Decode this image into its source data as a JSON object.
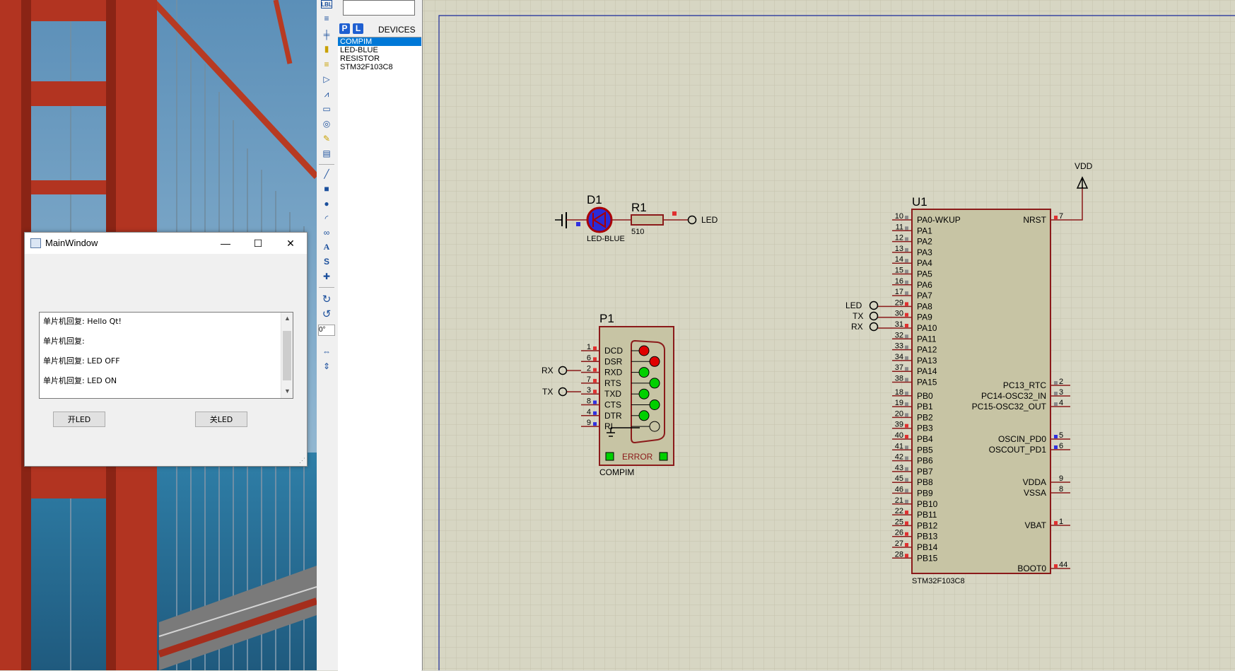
{
  "qt_window": {
    "title": "MainWindow",
    "minimize_glyph": "—",
    "maximize_glyph": "☐",
    "close_glyph": "✕",
    "log_lines": [
      "单片机回复: Hello Qt!",
      "单片机回复:",
      "单片机回复: LED OFF",
      "单片机回复: LED ON"
    ],
    "led_on_button": "开LED",
    "led_off_button": "关LED"
  },
  "device_panel": {
    "p_label": "P",
    "l_label": "L",
    "header": "DEVICES",
    "devices": [
      "COMPIM",
      "LED-BLUE",
      "RESISTOR",
      "STM32F103C8"
    ],
    "selected_index": 0
  },
  "toolbar": {
    "lbl_icon_text": "LBL",
    "rotation_value": "0°"
  },
  "schematic": {
    "d1": {
      "ref": "D1",
      "value": "LED-BLUE"
    },
    "r1": {
      "ref": "R1",
      "value": "510"
    },
    "led_terminal": "LED",
    "p1": {
      "ref": "P1",
      "value": "COMPIM",
      "error_label": "ERROR",
      "pins": [
        {
          "num": "1",
          "name": "DCD"
        },
        {
          "num": "6",
          "name": "DSR"
        },
        {
          "num": "2",
          "name": "RXD"
        },
        {
          "num": "7",
          "name": "RTS"
        },
        {
          "num": "3",
          "name": "TXD"
        },
        {
          "num": "8",
          "name": "CTS"
        },
        {
          "num": "4",
          "name": "DTR"
        },
        {
          "num": "9",
          "name": "RI"
        }
      ],
      "terminals": [
        "RX",
        "TX"
      ]
    },
    "vdd_label": "VDD",
    "u1": {
      "ref": "U1",
      "value": "STM32F103C8",
      "left_pins": [
        {
          "num": "10",
          "name": "PA0-WKUP"
        },
        {
          "num": "11",
          "name": "PA1"
        },
        {
          "num": "12",
          "name": "PA2"
        },
        {
          "num": "13",
          "name": "PA3"
        },
        {
          "num": "14",
          "name": "PA4"
        },
        {
          "num": "15",
          "name": "PA5"
        },
        {
          "num": "16",
          "name": "PA6"
        },
        {
          "num": "17",
          "name": "PA7"
        },
        {
          "num": "29",
          "name": "PA8"
        },
        {
          "num": "30",
          "name": "PA9"
        },
        {
          "num": "31",
          "name": "PA10"
        },
        {
          "num": "32",
          "name": "PA11"
        },
        {
          "num": "33",
          "name": "PA12"
        },
        {
          "num": "34",
          "name": "PA13"
        },
        {
          "num": "37",
          "name": "PA14"
        },
        {
          "num": "38",
          "name": "PA15"
        },
        {
          "num": "18",
          "name": "PB0"
        },
        {
          "num": "19",
          "name": "PB1"
        },
        {
          "num": "20",
          "name": "PB2"
        },
        {
          "num": "39",
          "name": "PB3"
        },
        {
          "num": "40",
          "name": "PB4"
        },
        {
          "num": "41",
          "name": "PB5"
        },
        {
          "num": "42",
          "name": "PB6"
        },
        {
          "num": "43",
          "name": "PB7"
        },
        {
          "num": "45",
          "name": "PB8"
        },
        {
          "num": "46",
          "name": "PB9"
        },
        {
          "num": "21",
          "name": "PB10"
        },
        {
          "num": "22",
          "name": "PB11"
        },
        {
          "num": "25",
          "name": "PB12"
        },
        {
          "num": "26",
          "name": "PB13"
        },
        {
          "num": "27",
          "name": "PB14"
        },
        {
          "num": "28",
          "name": "PB15"
        }
      ],
      "right_pins": [
        {
          "num": "7",
          "name": "NRST"
        },
        {
          "num": "2",
          "name": "PC13_RTC"
        },
        {
          "num": "3",
          "name": "PC14-OSC32_IN"
        },
        {
          "num": "4",
          "name": "PC15-OSC32_OUT"
        },
        {
          "num": "5",
          "name": "OSCIN_PD0"
        },
        {
          "num": "6",
          "name": "OSCOUT_PD1"
        },
        {
          "num": "9",
          "name": "VDDA"
        },
        {
          "num": "8",
          "name": "VSSA"
        },
        {
          "num": "1",
          "name": "VBAT"
        },
        {
          "num": "44",
          "name": "BOOT0"
        }
      ],
      "net_labels": [
        "LED",
        "TX",
        "RX"
      ]
    }
  },
  "colors": {
    "sheet_bg": "#d7d6c3",
    "grid": "#c4c3ae",
    "component_fill": "#c7c4a4",
    "component_border": "#8b1a1a",
    "wire": "#8b1a1a",
    "pin_red": "#e03030",
    "pin_blue": "#3030e0",
    "led_green": "#00d000",
    "led_red": "#e00000"
  }
}
